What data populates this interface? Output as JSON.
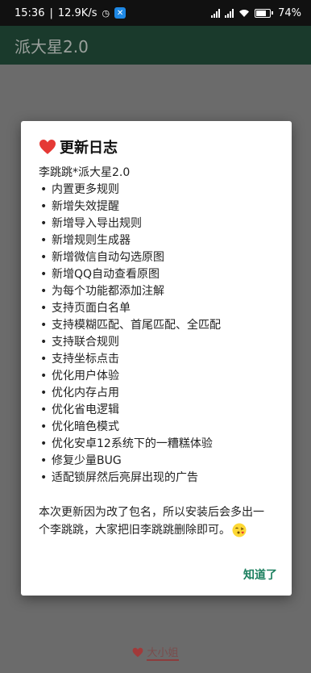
{
  "status_bar": {
    "time": "15:36",
    "speed": "12.9K/s",
    "battery": "74",
    "battery_level": 0.74
  },
  "app": {
    "title": "派大星2.0"
  },
  "dialog": {
    "title": "更新日志",
    "app_version": "李跳跳*派大星2.0",
    "bullet": "•",
    "changes": [
      "内置更多规则",
      "新增失效提醒",
      "新增导入导出规则",
      "新增规则生成器",
      "新增微信自动勾选原图",
      "新增QQ自动查看原图",
      "为每个功能都添加注解",
      "支持页面白名单",
      "支持模糊匹配、首尾匹配、全匹配",
      "支持联合规则",
      "支持坐标点击",
      "优化用户体验",
      "优化内存占用",
      "优化省电逻辑",
      "优化暗色模式",
      "优化安卓12系统下的一糟糕体验",
      "修复少量BUG",
      "适配锁屏然后亮屏出现的广告"
    ],
    "notice": "本次更新因为改了包名，所以安装后会多出一个李跳跳，大家把旧李跳跳删除即可。",
    "ok_label": "知道了"
  },
  "footer": {
    "label": "大小姐"
  },
  "colors": {
    "accent": "#1b7f5e",
    "heart": "#e53935",
    "overlay": "#6b6b6b",
    "app_bar": "#1a3a2c"
  }
}
